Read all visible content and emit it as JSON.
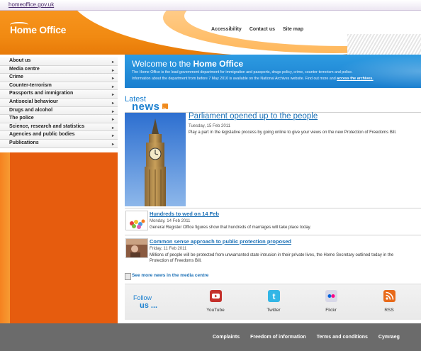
{
  "top_bar": {
    "site_link": "homeoffice.gov.uk"
  },
  "header": {
    "logo_text": "Home Office",
    "links": [
      "Accessibility",
      "Contact us",
      "Site map"
    ]
  },
  "sidebar": {
    "items": [
      {
        "label": "About us"
      },
      {
        "label": "Media centre"
      },
      {
        "label": "Crime"
      },
      {
        "label": "Counter-terrorism"
      },
      {
        "label": "Passports and immigration"
      },
      {
        "label": "Antisocial behaviour"
      },
      {
        "label": "Drugs and alcohol"
      },
      {
        "label": "The police"
      },
      {
        "label": "Science, research and statistics"
      },
      {
        "label": "Agencies and public bodies"
      },
      {
        "label": "Publications"
      }
    ]
  },
  "welcome": {
    "title_prefix": "Welcome to the ",
    "title_bold": "Home Office",
    "para1": "The Home Office is the lead government department for immigration and passports, drugs policy, crime, counter-terrorism and police.",
    "para2": "Information about the department from before 7 May 2010 is available on the National Archives website. Find out more and ",
    "para2_link": "access the archives."
  },
  "news": {
    "latest_label": "Latest",
    "news_label": "news",
    "lead": {
      "title": "Parliament opened up to the people",
      "date": "Tuesday, 15 Feb 2011",
      "desc": "Play a part in the legislative process by going online to give your views on the new Protection of Freedoms Bill."
    },
    "stories": [
      {
        "title": "Hundreds to wed on 14 Feb",
        "date": "Monday, 14 Feb 2011",
        "desc": "General Register Office figures show that hundreds of marriages will take place today."
      },
      {
        "title": "Common sense approach to public protection proposed",
        "date": "Friday, 11 Feb 2011",
        "desc": "Millions of people will be protected from unwarranted state intrusion in their private lives, the Home Secretary outlined today in the Protection of Freedoms Bill."
      }
    ],
    "more_link": "See more news in the media centre"
  },
  "follow": {
    "label1": "Follow",
    "label2": "us ...",
    "channels": [
      {
        "label": "YouTube",
        "icon": "youtube-icon",
        "color": "#c4302b"
      },
      {
        "label": "Twitter",
        "icon": "twitter-icon",
        "color": "#33b6e6"
      },
      {
        "label": "Flickr",
        "icon": "flickr-icon",
        "color": "#c8c8d8"
      },
      {
        "label": "RSS",
        "icon": "rss-icon",
        "color": "#e86a1a"
      }
    ]
  },
  "footer": {
    "links": [
      "Complaints",
      "Freedom of information",
      "Terms and conditions",
      "Cymraeg"
    ]
  },
  "colors": {
    "brand_orange": "#f18a12",
    "brand_blue": "#1a7fcf",
    "footer_grey": "#6b6b6b"
  }
}
